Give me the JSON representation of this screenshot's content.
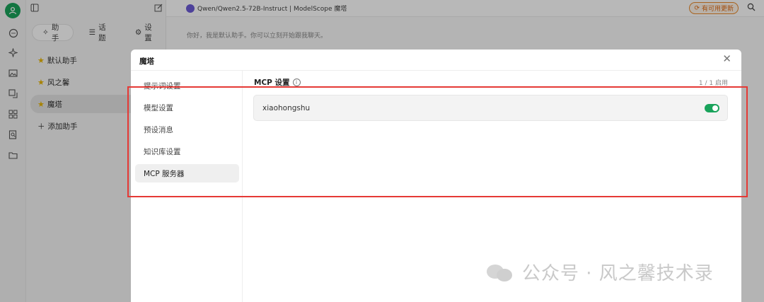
{
  "header": {
    "title": "Qwen/Qwen2.5-72B-Instruct | ModelScope 魔塔",
    "update_label": "有可用更新"
  },
  "assistant_panel": {
    "tabs": [
      {
        "label": "助手",
        "icon": "sparkle-icon"
      },
      {
        "label": "话题",
        "icon": "list-icon"
      },
      {
        "label": "设置",
        "icon": "gear-icon"
      }
    ],
    "items": [
      {
        "label": "默认助手"
      },
      {
        "label": "风之馨"
      },
      {
        "label": "魔塔"
      }
    ],
    "add_label": "添加助手"
  },
  "chat": {
    "greeting": "你好，我是默认助手。你可以立刻开始跟我聊天。"
  },
  "modal": {
    "title": "魔塔",
    "nav": [
      {
        "label": "提示词设置"
      },
      {
        "label": "模型设置"
      },
      {
        "label": "预设消息"
      },
      {
        "label": "知识库设置"
      },
      {
        "label": "MCP 服务器"
      }
    ],
    "content": {
      "title": "MCP 设置",
      "count": "1 / 1 启用",
      "servers": [
        {
          "name": "xiaohongshu",
          "enabled": true
        }
      ]
    }
  },
  "watermark": "公众号 · 风之馨技术录",
  "colors": {
    "accent_green": "#19a35b",
    "annotation_red": "#e53935",
    "update_orange": "#e06a10"
  }
}
